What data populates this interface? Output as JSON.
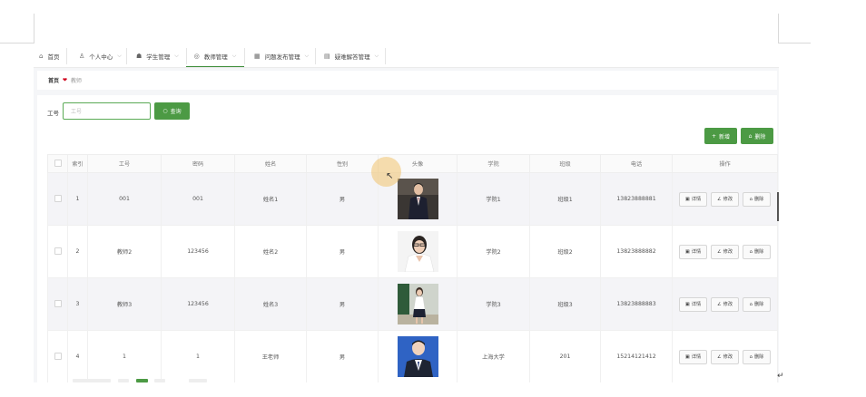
{
  "nav": [
    {
      "icon": "home-icon",
      "glyph": "⌂",
      "label": "首页",
      "chevron": false
    },
    {
      "icon": "user-icon",
      "glyph": "♙",
      "label": "个人中心",
      "chevron": true
    },
    {
      "icon": "student-icon",
      "glyph": "☗",
      "label": "学生管理",
      "chevron": true
    },
    {
      "icon": "teacher-icon",
      "glyph": "◎",
      "label": "教师管理",
      "chevron": true,
      "active": true
    },
    {
      "icon": "question-icon",
      "glyph": "▦",
      "label": "问题发布管理",
      "chevron": true
    },
    {
      "icon": "answer-icon",
      "glyph": "▤",
      "label": "疑难解答管理",
      "chevron": true
    }
  ],
  "breadcrumb": {
    "home": "首页",
    "heart": "❤",
    "current": "教师"
  },
  "search": {
    "label": "工号",
    "placeholder": "工号",
    "button": "查询",
    "button_icon": "○"
  },
  "actions": {
    "add": "新增",
    "add_icon": "+",
    "delete": "删除",
    "delete_icon": "⌂"
  },
  "table": {
    "headers": [
      "",
      "索引",
      "工号",
      "密码",
      "姓名",
      "性别",
      "头像",
      "学院",
      "班级",
      "电话",
      "操作"
    ],
    "rows": [
      {
        "index": "1",
        "gonghao": "001",
        "password": "001",
        "name": "姓名1",
        "gender": "男",
        "avatar": "photo-1",
        "college": "学院1",
        "class": "班级1",
        "phone": "13823888881"
      },
      {
        "index": "2",
        "gonghao": "教师2",
        "password": "123456",
        "name": "姓名2",
        "gender": "男",
        "avatar": "photo-2",
        "college": "学院2",
        "class": "班级2",
        "phone": "13823888882"
      },
      {
        "index": "3",
        "gonghao": "教师3",
        "password": "123456",
        "name": "姓名3",
        "gender": "男",
        "avatar": "photo-3",
        "college": "学院3",
        "class": "班级3",
        "phone": "13823888883"
      },
      {
        "index": "4",
        "gonghao": "1",
        "password": "1",
        "name": "王老师",
        "gender": "男",
        "avatar": "photo-4",
        "college": "上海大学",
        "class": "201",
        "phone": "15214121412"
      }
    ],
    "ops": {
      "detail": "详情",
      "detail_icon": "▣",
      "edit": "修改",
      "edit_icon": "∠",
      "delete": "删除",
      "delete_icon": "⌂"
    }
  },
  "colors": {
    "accent": "#4c9a44",
    "heart": "#d0021b"
  }
}
